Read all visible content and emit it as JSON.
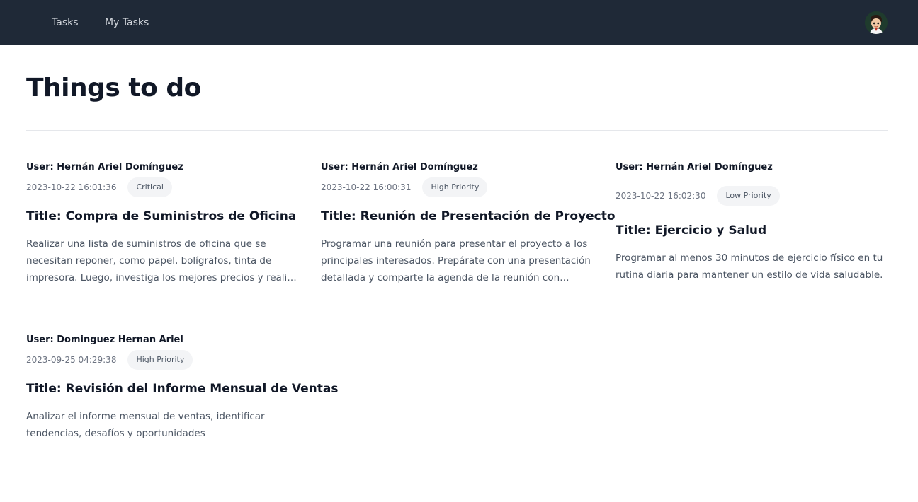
{
  "nav": {
    "tasks_label": "Tasks",
    "my_tasks_label": "My Tasks"
  },
  "page": {
    "title": "Things to do"
  },
  "tasks": [
    {
      "user": "User: Hernán Ariel Domínguez",
      "date": "2023-10-22 16:01:36",
      "priority": "Critical",
      "title": "Title: Compra de Suministros de Oficina",
      "description": "Realizar una lista de suministros de oficina que se necesitan reponer, como papel, bolígrafos, tinta de impresora. Luego, investiga los mejores precios y realiza la compra en línea o en una tienda local."
    },
    {
      "user": "User: Hernán Ariel Domínguez",
      "date": "2023-10-22 16:00:31",
      "priority": "High Priority",
      "title": "Title: Reunión de Presentación de Proyecto",
      "description": "Programar una reunión para presentar el proyecto a los principales interesados. Prepárate con una presentación detallada y comparte la agenda de la reunión con antelación a los asistentes."
    },
    {
      "user": "User: Hernán Ariel Domínguez",
      "date": "2023-10-22 16:02:30",
      "priority": "Low Priority",
      "title": "Title: Ejercicio y Salud",
      "description": "Programar al menos 30 minutos de ejercicio físico en tu rutina diaria para mantener un estilo de vida saludable."
    },
    {
      "user": "User: Dominguez Hernan Ariel",
      "date": "2023-09-25 04:29:38",
      "priority": "High Priority",
      "title": "Title: Revisión del Informe Mensual de Ventas",
      "description": "Analizar el informe mensual de ventas, identificar tendencias, desafíos y oportunidades"
    }
  ]
}
